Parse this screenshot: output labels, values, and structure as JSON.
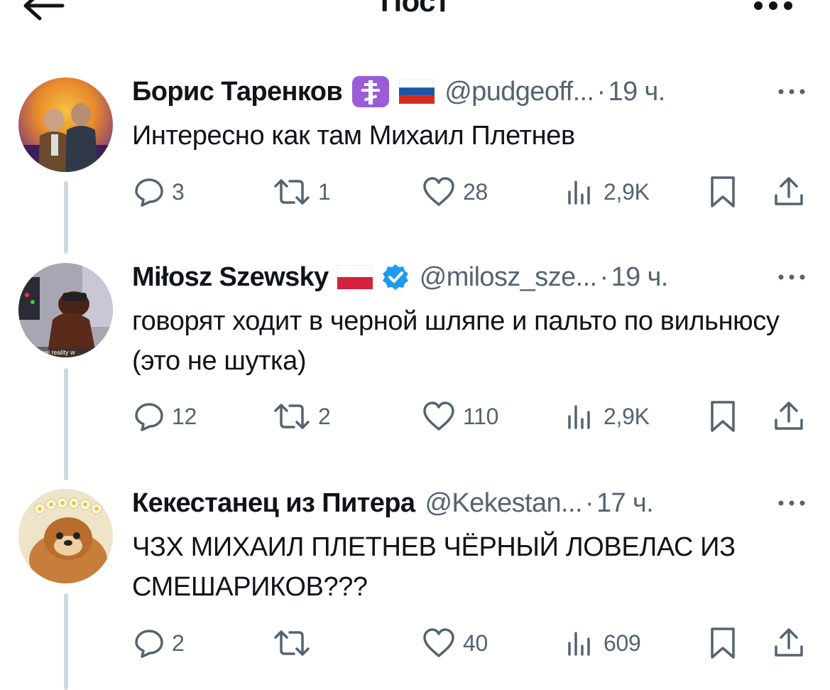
{
  "header": {
    "title": "Пост",
    "back_icon": "arrow-left-icon",
    "more_icon": "more-horizontal-icon"
  },
  "posts": [
    {
      "name": "Борис Таренков",
      "handle": "@pudgeoff...",
      "dot": "·",
      "time": "19 ч.",
      "badges": [
        "orthodox-cross-emoji-icon",
        "russia-flag-icon"
      ],
      "text": "Интересно как там Михаил Плетнев",
      "replies": "3",
      "reposts": "1",
      "likes": "28",
      "views": "2,9K"
    },
    {
      "name": "Miłosz Szewsky",
      "handle": "@milosz_sze...",
      "dot": "·",
      "time": "19 ч.",
      "badges": [
        "poland-flag-icon",
        "verified-icon"
      ],
      "avatar_caption": "virtual reality w",
      "text": "говорят ходит в черной шляпе и пальто по вильнюсу (это не шутка)",
      "replies": "12",
      "reposts": "2",
      "likes": "110",
      "views": "2,9K"
    },
    {
      "name": "Кекестанец из Питера",
      "handle": "@Kekestan...",
      "dot": "·",
      "time": "17 ч.",
      "badges": [],
      "text": "ЧЗХ МИХАИЛ ПЛЕТНЕВ ЧЁРНЫЙ ЛОВЕЛАС ИЗ СМЕШАРИКОВ???",
      "replies": "2",
      "reposts": "",
      "likes": "40",
      "views": "609"
    }
  ],
  "colors": {
    "text": "#0f1419",
    "secondary": "#536471",
    "thread_line": "#cfd9de",
    "verified": "#1d9bf0",
    "cross_badge": "#9a5dd6"
  }
}
